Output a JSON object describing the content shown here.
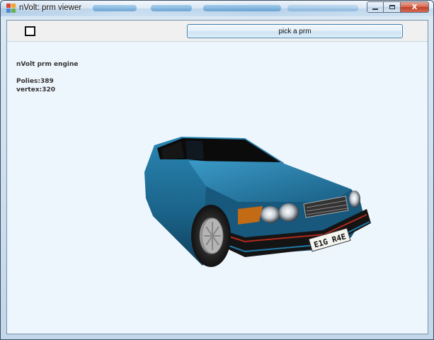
{
  "window": {
    "title": "nVolt: prm viewer",
    "caption_buttons": {
      "minimize": "minimize",
      "maximize": "maximize",
      "close": "X"
    }
  },
  "toolbar": {
    "checkbox_checked": false,
    "pick_button_label": "pick a prm"
  },
  "viewport": {
    "engine_label": "nVolt prm engine",
    "polies": "Polies:389",
    "vertex": "vertex:320",
    "license_plate": "E1G R4E",
    "background_color": "#eef6fd",
    "car_color": "#1f6f99"
  },
  "icons": [
    "app-icon",
    "minimize-icon",
    "maximize-icon",
    "close-icon"
  ]
}
